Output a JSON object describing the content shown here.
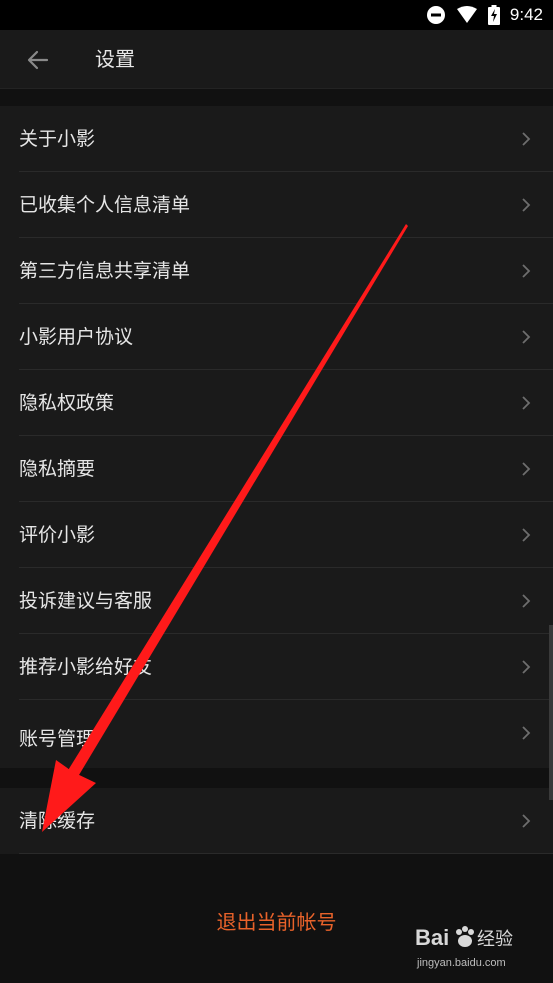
{
  "status_bar": {
    "time": "9:42",
    "icons": [
      "do-not-disturb-icon",
      "wifi-icon",
      "battery-charging-icon"
    ]
  },
  "header": {
    "title": "设置",
    "back_icon": "arrow-left-icon"
  },
  "settings_group_1": [
    {
      "label": "关于小影"
    },
    {
      "label": "已收集个人信息清单"
    },
    {
      "label": "第三方信息共享清单"
    },
    {
      "label": "小影用户协议"
    },
    {
      "label": "隐私权政策"
    },
    {
      "label": "隐私摘要"
    },
    {
      "label": "评价小影"
    },
    {
      "label": "投诉建议与客服"
    },
    {
      "label": "推荐小影给好友"
    },
    {
      "label": "账号管理"
    }
  ],
  "settings_group_2": [
    {
      "label": "清除缓存"
    }
  ],
  "logout": {
    "label": "退出当前帐号"
  },
  "watermark": {
    "brand": "Bai",
    "brand_suffix": "经验",
    "url": "jingyan.baidu.com"
  },
  "colors": {
    "background": "#111111",
    "surface": "#1a1a1a",
    "text": "#e6e6e6",
    "logout": "#e8622a",
    "annotation_arrow": "#ff1a1a"
  }
}
